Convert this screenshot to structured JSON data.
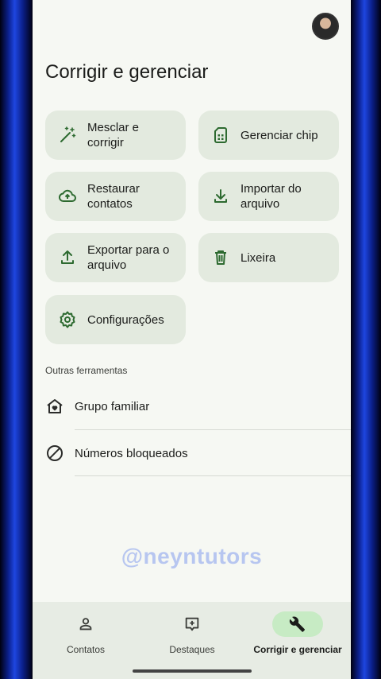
{
  "header": {
    "title": "Corrigir e gerenciar"
  },
  "cards": {
    "merge": "Mesclar e corrigir",
    "sim": "Gerenciar chip",
    "restore": "Restaurar contatos",
    "import": "Importar do arquivo",
    "export": "Exportar para o arquivo",
    "trash": "Lixeira",
    "settings": "Configurações"
  },
  "other_tools": {
    "title": "Outras ferramentas",
    "family": "Grupo familiar",
    "blocked": "Números bloqueados"
  },
  "watermark": "@neyntutors",
  "bottom_nav": {
    "contacts": "Contatos",
    "highlights": "Destaques",
    "fix": "Corrigir e gerenciar"
  },
  "colors": {
    "accent": "#2d6a30",
    "card_bg": "#e3eadf",
    "active_pill": "#c7ebc4"
  }
}
